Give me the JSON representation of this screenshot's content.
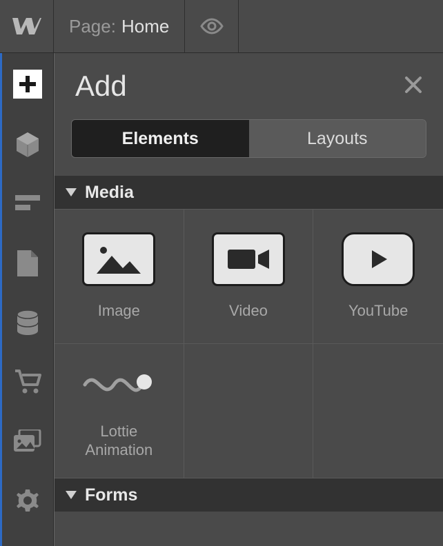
{
  "topbar": {
    "page_label": "Page:",
    "page_name": "Home"
  },
  "panel": {
    "title": "Add",
    "tabs": {
      "elements": "Elements",
      "layouts": "Layouts"
    },
    "sections": {
      "media": {
        "title": "Media",
        "items": {
          "image": "Image",
          "video": "Video",
          "youtube": "YouTube",
          "lottie": "Lottie\nAnimation"
        }
      },
      "forms": {
        "title": "Forms"
      }
    }
  },
  "sidebar": {
    "items": [
      "add",
      "box",
      "layout",
      "page",
      "database",
      "cart",
      "assets",
      "settings"
    ]
  }
}
